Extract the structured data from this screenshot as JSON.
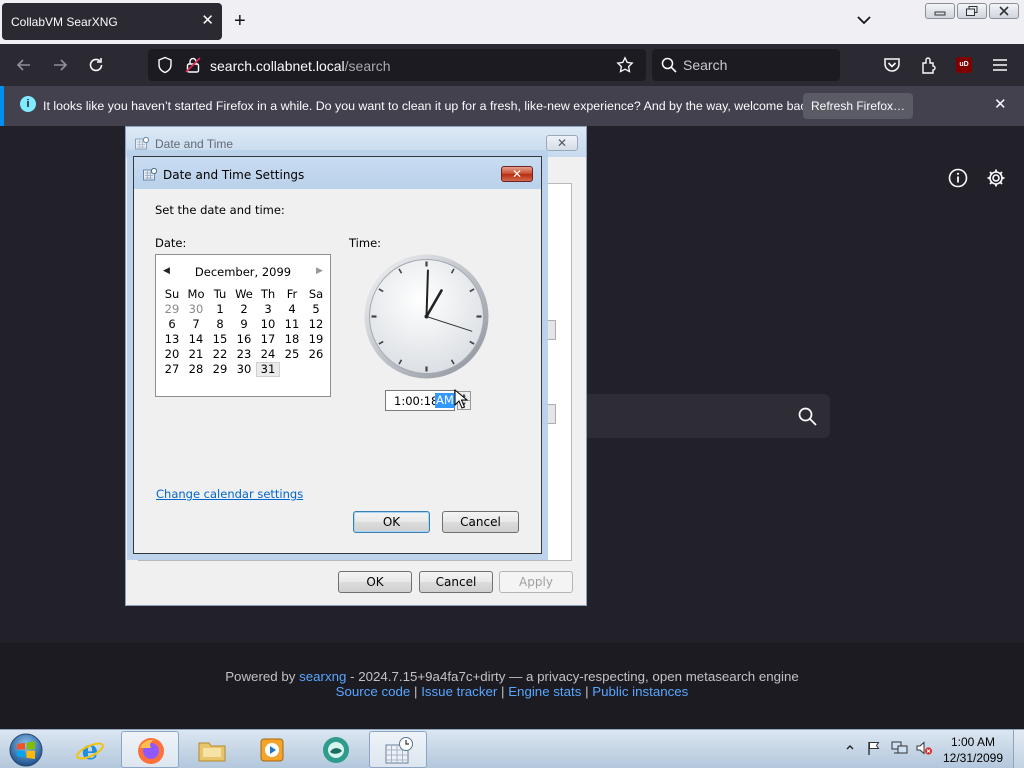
{
  "browser": {
    "tab_title": "CollabVM SearXNG",
    "url_host": "search.collabnet.local",
    "url_path": "/search",
    "search_placeholder": "Search",
    "ublock_badge": "uD"
  },
  "notification": {
    "message": "It looks like you haven’t started Firefox in a while. Do you want to clean it up for a fresh, like-new experience? And by the way, welcome back!",
    "button_label": "Refresh Firefox…",
    "info_glyph": "i"
  },
  "footer": {
    "powered_by": "Powered by",
    "searxng_link": "searxng",
    "version_text": "- 2024.7.15+9a4fa7c+dirty — a privacy-respecting, open metasearch engine",
    "source_code": "Source code",
    "issue_tracker": "Issue tracker",
    "engine_stats": "Engine stats",
    "public_instances": "Public instances",
    "separator": "|"
  },
  "outer_dialog": {
    "title": "Date and Time",
    "ok_label": "OK",
    "cancel_label": "Cancel",
    "apply_label": "Apply"
  },
  "settings_dialog": {
    "title": "Date and Time Settings",
    "instruction": "Set the date and time:",
    "date_label": "Date:",
    "time_label": "Time:",
    "calendar": {
      "month_year": "December, 2099",
      "weekdays": [
        "Su",
        "Mo",
        "Tu",
        "We",
        "Th",
        "Fr",
        "Sa"
      ],
      "weeks": [
        [
          "29",
          "30",
          "1",
          "2",
          "3",
          "4",
          "5"
        ],
        [
          "6",
          "7",
          "8",
          "9",
          "10",
          "11",
          "12"
        ],
        [
          "13",
          "14",
          "15",
          "16",
          "17",
          "18",
          "19"
        ],
        [
          "20",
          "21",
          "22",
          "23",
          "24",
          "25",
          "26"
        ],
        [
          "27",
          "28",
          "29",
          "30",
          "31",
          "",
          ""
        ]
      ],
      "selected_day": "31"
    },
    "clock": {
      "hour": 1,
      "minute": 0,
      "second": 18
    },
    "time_value": "1:00:18",
    "time_ampm": "AM",
    "change_calendar_link": "Change calendar settings",
    "ok_label": "OK",
    "cancel_label": "Cancel"
  },
  "taskbar": {
    "apps": [
      "internet-explorer",
      "firefox",
      "file-explorer",
      "media-player",
      "collab-app",
      "date-time-control-panel"
    ],
    "active_app": "date-time-control-panel",
    "clock_time": "1:00 AM",
    "clock_date": "12/31/2099"
  },
  "colors": {
    "accent": "#0090ed",
    "selection": "#3399ff",
    "link": "#0066cc",
    "footer_link": "#58a6ff"
  }
}
